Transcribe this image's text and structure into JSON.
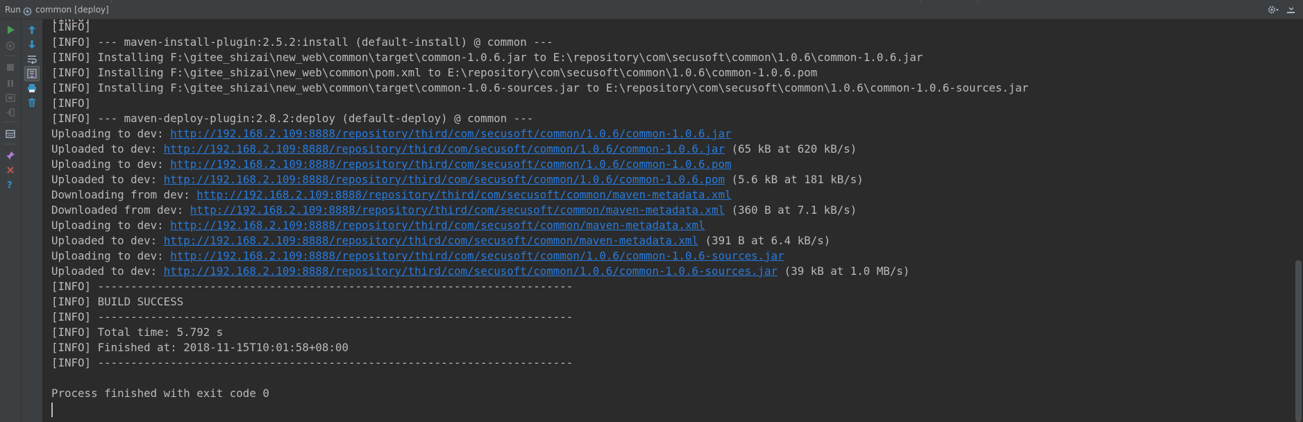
{
  "titlebar": {
    "run_label": "Run",
    "config_label": "common [deploy]"
  },
  "icons": {
    "rerun": "run-triangle-icon",
    "up": "arrow-up-icon",
    "down": "arrow-down-icon",
    "wrap": "soft-wrap-icon",
    "scroll_end": "scroll-to-end-icon",
    "print": "print-icon",
    "clear": "trash-icon",
    "settings": "gear-icon",
    "hide": "hide-panel-icon",
    "close": "close-icon",
    "help": "help-icon"
  },
  "colors": {
    "background": "#2b2b2b",
    "panel": "#3c3f41",
    "text": "#bbbbbb",
    "link": "#287bde",
    "run_green": "#499c54",
    "arrow_blue": "#3592c4",
    "close_red": "#c75450"
  },
  "console": {
    "partial_line": "[INFO] ---------------------------------------------------------------------",
    "lines": [
      {
        "text": "[INFO]"
      },
      {
        "text": "[INFO] --- maven-install-plugin:2.5.2:install (default-install) @ common ---"
      },
      {
        "text": "[INFO] Installing F:\\gitee_shizai\\new_web\\common\\target\\common-1.0.6.jar to E:\\repository\\com\\secusoft\\common\\1.0.6\\common-1.0.6.jar"
      },
      {
        "text": "[INFO] Installing F:\\gitee_shizai\\new_web\\common\\pom.xml to E:\\repository\\com\\secusoft\\common\\1.0.6\\common-1.0.6.pom"
      },
      {
        "text": "[INFO] Installing F:\\gitee_shizai\\new_web\\common\\target\\common-1.0.6-sources.jar to E:\\repository\\com\\secusoft\\common\\1.0.6\\common-1.0.6-sources.jar"
      },
      {
        "text": "[INFO]"
      },
      {
        "text": "[INFO] --- maven-deploy-plugin:2.8.2:deploy (default-deploy) @ common ---"
      },
      {
        "text": "Uploading to dev: ",
        "link": "http://192.168.2.109:8888/repository/third/com/secusoft/common/1.0.6/common-1.0.6.jar"
      },
      {
        "text": "Uploaded to dev: ",
        "link": "http://192.168.2.109:8888/repository/third/com/secusoft/common/1.0.6/common-1.0.6.jar",
        "suffix": " (65 kB at 620 kB/s)"
      },
      {
        "text": "Uploading to dev: ",
        "link": "http://192.168.2.109:8888/repository/third/com/secusoft/common/1.0.6/common-1.0.6.pom"
      },
      {
        "text": "Uploaded to dev: ",
        "link": "http://192.168.2.109:8888/repository/third/com/secusoft/common/1.0.6/common-1.0.6.pom",
        "suffix": " (5.6 kB at 181 kB/s)"
      },
      {
        "text": "Downloading from dev: ",
        "link": "http://192.168.2.109:8888/repository/third/com/secusoft/common/maven-metadata.xml"
      },
      {
        "text": "Downloaded from dev: ",
        "link": "http://192.168.2.109:8888/repository/third/com/secusoft/common/maven-metadata.xml",
        "suffix": " (360 B at 7.1 kB/s)"
      },
      {
        "text": "Uploading to dev: ",
        "link": "http://192.168.2.109:8888/repository/third/com/secusoft/common/maven-metadata.xml"
      },
      {
        "text": "Uploaded to dev: ",
        "link": "http://192.168.2.109:8888/repository/third/com/secusoft/common/maven-metadata.xml",
        "suffix": " (391 B at 6.4 kB/s)"
      },
      {
        "text": "Uploading to dev: ",
        "link": "http://192.168.2.109:8888/repository/third/com/secusoft/common/1.0.6/common-1.0.6-sources.jar"
      },
      {
        "text": "Uploaded to dev: ",
        "link": "http://192.168.2.109:8888/repository/third/com/secusoft/common/1.0.6/common-1.0.6-sources.jar",
        "suffix": " (39 kB at 1.0 MB/s)"
      },
      {
        "text": "[INFO] ------------------------------------------------------------------------"
      },
      {
        "text": "[INFO] BUILD SUCCESS"
      },
      {
        "text": "[INFO] ------------------------------------------------------------------------"
      },
      {
        "text": "[INFO] Total time: 5.792 s"
      },
      {
        "text": "[INFO] Finished at: 2018-11-15T10:01:58+08:00"
      },
      {
        "text": "[INFO] ------------------------------------------------------------------------"
      },
      {
        "text": ""
      },
      {
        "text": "Process finished with exit code 0"
      }
    ]
  }
}
